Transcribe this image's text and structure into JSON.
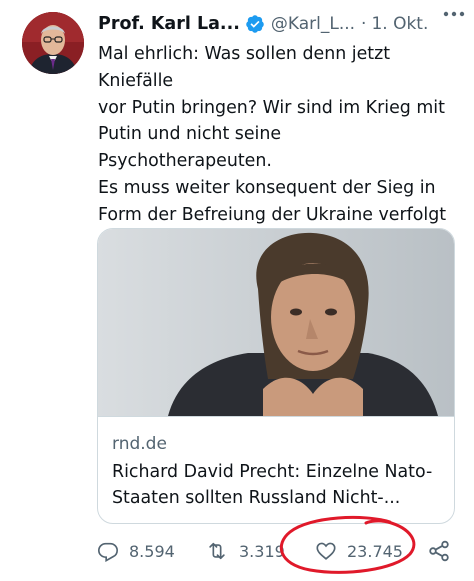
{
  "tweet": {
    "author_name": "Prof. Karl La...",
    "author_handle": "@Karl_L...",
    "separator": "·",
    "date": "1. Okt.",
    "text": "Mal ehrlich: Was sollen denn jetzt Kniefälle\nvor Putin bringen? Wir sind im Krieg mit\nPutin und nicht seine Psychotherapeuten.\nEs muss weiter konsequent der Sieg in\nForm der Befreiung der Ukraine verfolgt\nwerden. Ob das Putins Psyche verkraftet\nist egal",
    "verified": true
  },
  "link_card": {
    "domain": "rnd.de",
    "title": "Richard David Precht: Einzelne Nato-\nStaaten sollten Russland Nicht-..."
  },
  "actions": {
    "reply_count": "8.594",
    "retweet_count": "3.319",
    "like_count": "23.745"
  },
  "icons": {
    "verified": "verified-badge-icon",
    "more": "more-options-icon",
    "reply": "reply-icon",
    "retweet": "retweet-icon",
    "like": "heart-icon",
    "share": "share-icon"
  },
  "colors": {
    "text_primary": "#0f1419",
    "text_secondary": "#536471",
    "verified_blue": "#1d9bf0",
    "border": "#cfd9de",
    "annotation_red": "#e0192a"
  }
}
